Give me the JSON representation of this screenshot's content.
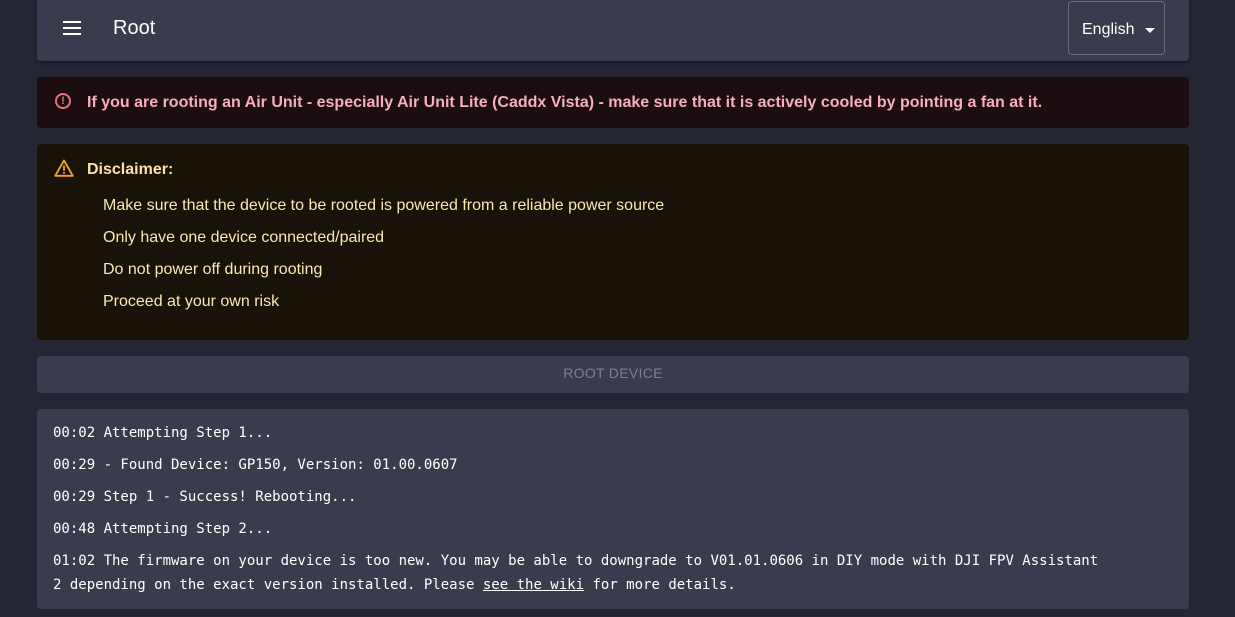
{
  "appbar": {
    "title": "Root",
    "language": "English"
  },
  "error_alert": {
    "text": "If you are rooting an Air Unit - especially Air Unit Lite (Caddx Vista) - make sure that it is actively cooled by pointing a fan at it."
  },
  "disclaimer": {
    "title": "Disclaimer:",
    "items": [
      "Make sure that the device to be rooted is powered from a reliable power source",
      "Only have one device connected/paired",
      "Do not power off during rooting",
      "Proceed at your own risk"
    ]
  },
  "root_button": {
    "label": "ROOT DEVICE"
  },
  "log": {
    "lines": [
      "00:02 Attempting Step 1...",
      "00:29 - Found Device: GP150, Version: 01.00.0607",
      "00:29 Step 1 - Success! Rebooting...",
      "00:48 Attempting Step 2..."
    ],
    "last_line_part1": "01:02 The firmware on your device is too new. You may be able to downgrade to V01.01.0606 in DIY mode with DJI FPV Assistant",
    "last_line_part2_prefix": "2 depending on the exact version installed. Please ",
    "last_line_link": "see the wiki",
    "last_line_suffix": " for more details."
  },
  "colors": {
    "background": "#252633",
    "surface": "#3a3c4e",
    "error_bg": "#1c0d10",
    "error_text": "#f6b0ba",
    "warning_bg": "#181208",
    "warning_text": "#fde6b2",
    "warning_icon": "#f5a623"
  },
  "icons": {
    "menu": "menu-icon",
    "error": "error-outline-icon",
    "warning": "warning-triangle-icon",
    "dropdown": "caret-down-icon"
  }
}
